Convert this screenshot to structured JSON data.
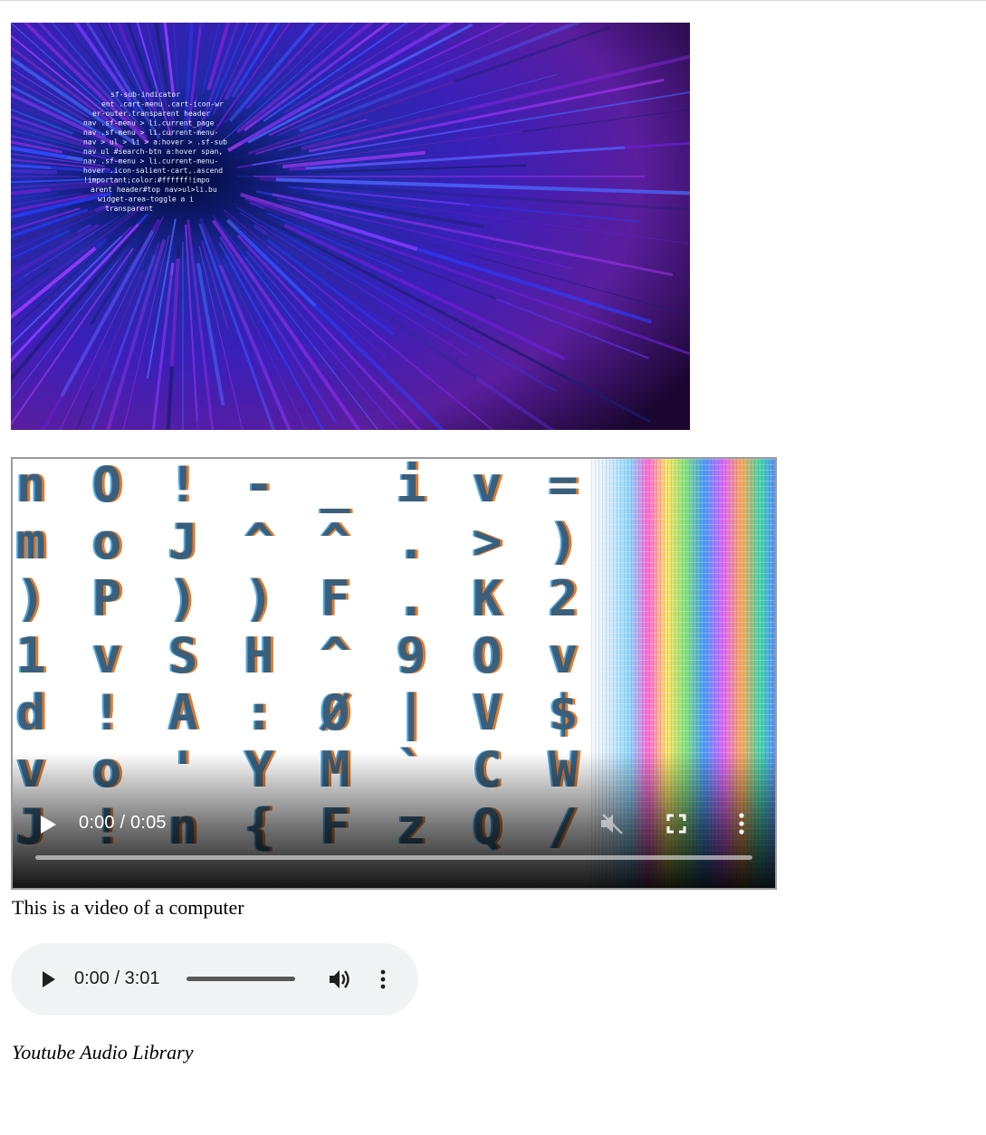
{
  "hero_image": {
    "code_lines": [
      "sf-sub-indicator",
      "ent .cart-menu .cart-icon-wr",
      "er-outer.transparent header",
      "nav .sf-menu > li.current_page",
      "nav .sf-menu > li.current-menu-",
      "nav > ul > li > a:hover > .sf-sub",
      "nav ul #search-btn a:hover span,",
      "nav .sf-menu > li.current-menu-",
      "hover .icon-salient-cart,.ascend",
      "!important;color:#ffffff!impo",
      "arent header#top nav>ul>li.bu",
      "widget-area-toggle a i",
      "transparent"
    ]
  },
  "video": {
    "glyph_rows": [
      [
        "n",
        "O",
        "!",
        "-",
        "_",
        "i",
        "v",
        "="
      ],
      [
        "m",
        "o",
        "J",
        "^",
        "^",
        ".",
        ">",
        ")"
      ],
      [
        ")",
        "P",
        ")",
        ")",
        "F",
        ".",
        "K",
        "2"
      ],
      [
        "1",
        "v",
        "S",
        "H",
        "^",
        "9",
        "O",
        "v"
      ],
      [
        "d",
        "!",
        "A",
        ":",
        "Ø",
        "|",
        "V",
        "$"
      ],
      [
        "v",
        "o",
        "'",
        "Y",
        "M",
        "`",
        "C",
        "W"
      ],
      [
        "J",
        "!",
        "n",
        "{",
        "F",
        "z",
        "Q",
        "/"
      ]
    ],
    "time": "0:00 / 0:05",
    "progress": 0.0,
    "icons": {
      "play": "play-icon",
      "volume": "volume-muted-icon",
      "fullscreen": "fullscreen-icon",
      "more": "more-vert-icon"
    }
  },
  "caption": "This is a video of a computer",
  "audio": {
    "time": "0:00 / 3:01",
    "progress": 0.0,
    "icons": {
      "play": "play-icon",
      "volume": "volume-up-icon",
      "more": "more-vert-icon"
    }
  },
  "source_credit": "Youtube Audio Library"
}
